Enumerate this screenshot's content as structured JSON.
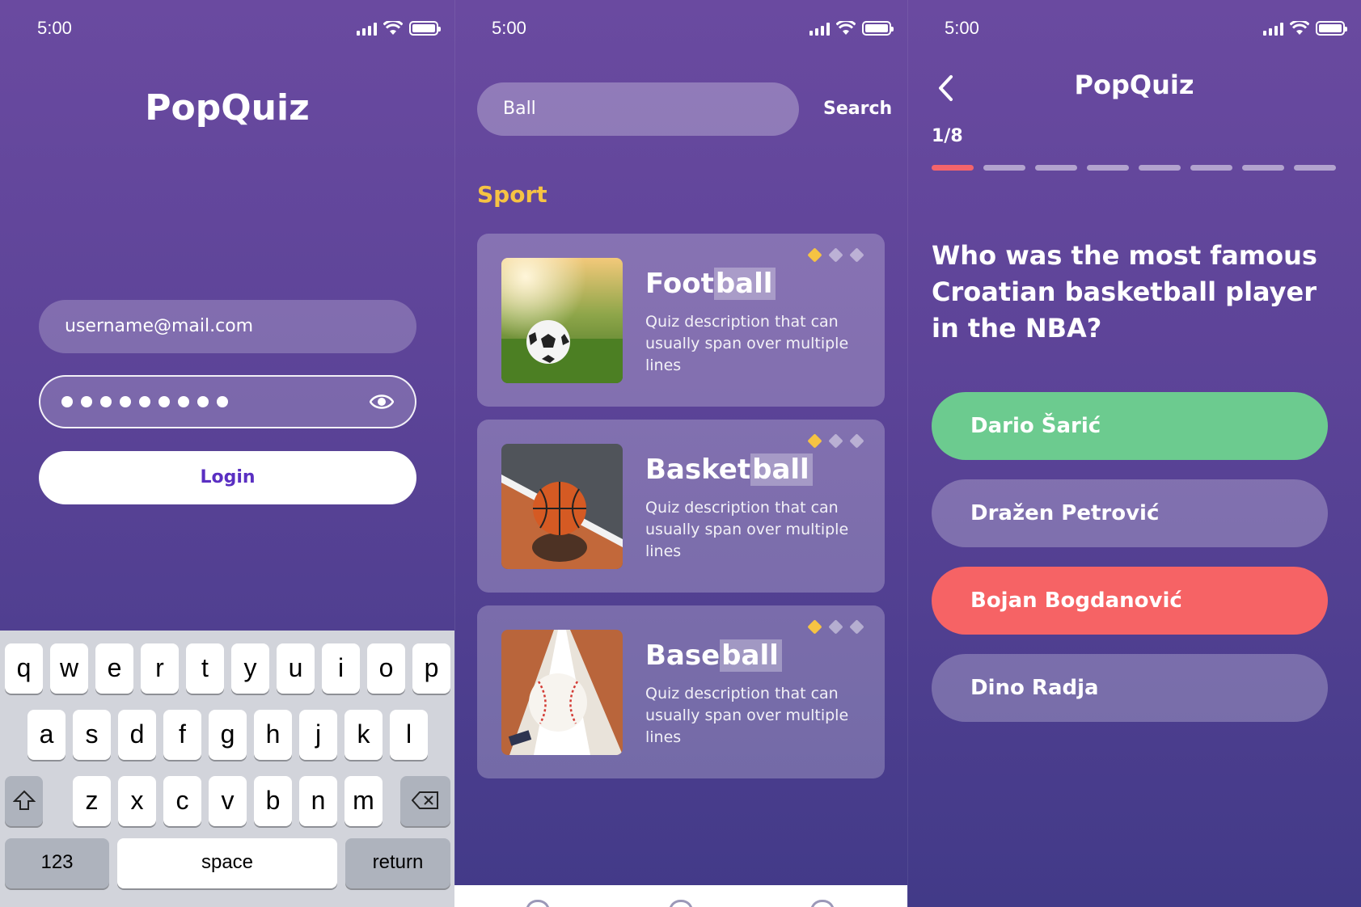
{
  "status_bar": {
    "time": "5:00"
  },
  "login": {
    "app_title": "PopQuiz",
    "email_value": "username@mail.com",
    "password_masked_count": 9,
    "login_label": "Login"
  },
  "keyboard": {
    "row1": [
      "q",
      "w",
      "e",
      "r",
      "t",
      "y",
      "u",
      "i",
      "o",
      "p"
    ],
    "row2": [
      "a",
      "s",
      "d",
      "f",
      "g",
      "h",
      "j",
      "k",
      "l"
    ],
    "row3": [
      "z",
      "x",
      "c",
      "v",
      "b",
      "n",
      "m"
    ],
    "numbers_label": "123",
    "space_label": "space",
    "return_label": "return",
    "shift_icon": "shift-icon",
    "backspace_icon": "backspace-icon"
  },
  "search": {
    "query": "Ball",
    "button_label": "Search",
    "section_title": "Sport",
    "results": [
      {
        "title_prefix": "Foot",
        "title_match": "ball",
        "description": "Quiz description that can usually span over multiple lines",
        "difficulty": 1,
        "image": "football-photo"
      },
      {
        "title_prefix": "Basket",
        "title_match": "ball",
        "description": "Quiz description that can usually span over multiple lines",
        "difficulty": 1,
        "image": "basketball-photo"
      },
      {
        "title_prefix": "Base",
        "title_match": "ball",
        "description": "Quiz description that can usually span over multiple lines",
        "difficulty": 1,
        "image": "baseball-photo"
      }
    ],
    "difficulty_max": 3
  },
  "quiz": {
    "title": "PopQuiz",
    "progress_text": "1/8",
    "progress_current": 1,
    "progress_total": 8,
    "question": "Who was the most famous Croatian basketball player in the NBA?",
    "answers": [
      {
        "label": "Dario Šarić",
        "state": "correct"
      },
      {
        "label": "Dražen Petrović",
        "state": "neutral"
      },
      {
        "label": "Bojan Bogdanović",
        "state": "wrong"
      },
      {
        "label": "Dino Radja",
        "state": "neutral"
      }
    ]
  },
  "colors": {
    "accent_yellow": "#f6c343",
    "correct": "#6ccb8f",
    "wrong": "#f66365",
    "login_text": "#5a2fc2"
  }
}
